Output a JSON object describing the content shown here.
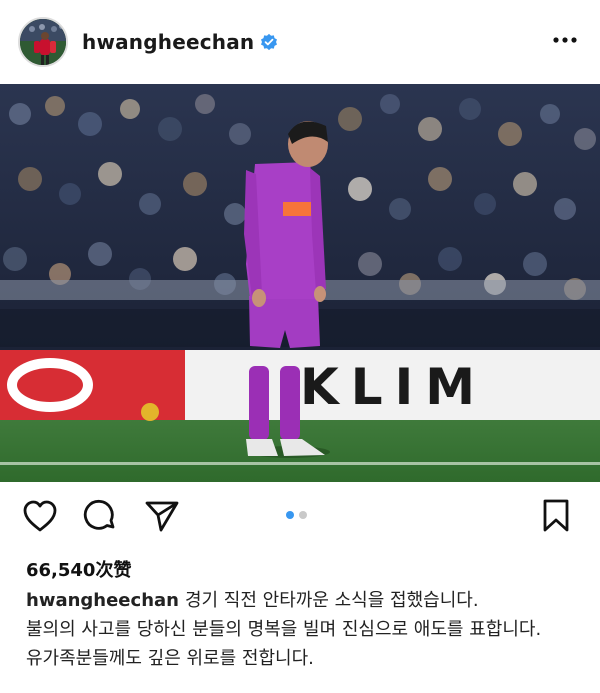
{
  "header": {
    "username": "hwangheechan",
    "verified": true,
    "avatar_icon": "profile-avatar",
    "more_icon": "more-options-icon"
  },
  "post": {
    "image_alt": "Player in purple kit standing with head bowed on pitch",
    "carousel": {
      "total": 2,
      "current": 1
    },
    "accent_color": "#3897f0"
  },
  "actions": {
    "like_icon": "heart-icon",
    "comment_icon": "comment-icon",
    "share_icon": "send-icon",
    "save_icon": "bookmark-icon"
  },
  "likes": {
    "label": "66,540次赞"
  },
  "caption": {
    "username": "hwangheechan",
    "line1": "경기 직전 안타까운 소식을 접했습니다.",
    "line2": "불의의 사고를 당하신 분들의 명복을 빌며 진심으로 애도를 표합니다.",
    "line3": "유가족분들께도 깊은 위로를 전합니다."
  }
}
